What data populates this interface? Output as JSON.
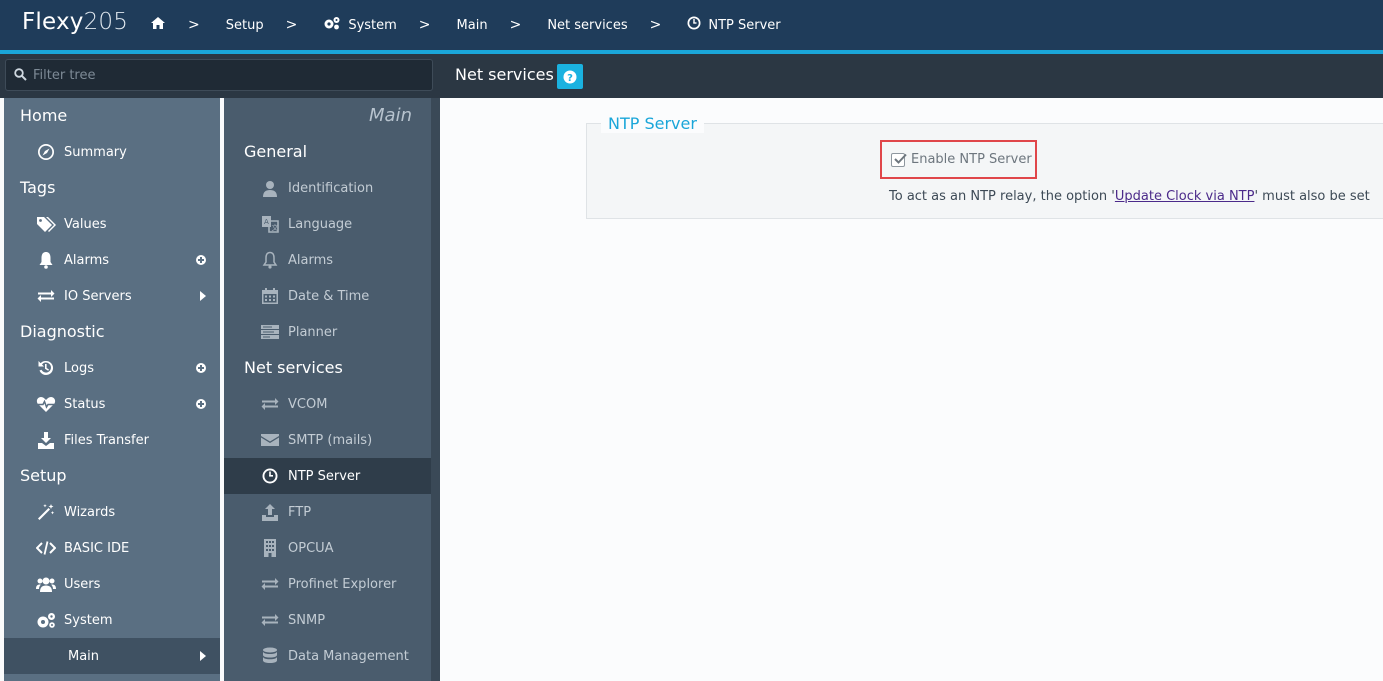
{
  "app": {
    "logo_main": "Flexy",
    "logo_model": "205"
  },
  "breadcrumb": {
    "items": [
      {
        "label": "",
        "icon": "home-icon"
      },
      {
        "label": "Setup"
      },
      {
        "label": "System",
        "icon": "gears-icon"
      },
      {
        "label": "Main"
      },
      {
        "label": "Net services"
      },
      {
        "label": "NTP Server",
        "icon": "clock-icon"
      }
    ],
    "separator": ">"
  },
  "filter": {
    "placeholder": "Filter tree"
  },
  "page": {
    "title": "Net services",
    "help_label": "?"
  },
  "nav1": {
    "sections": [
      {
        "label": "Home",
        "items": [
          {
            "label": "Summary",
            "icon": "compass-icon"
          }
        ]
      },
      {
        "label": "Tags",
        "items": [
          {
            "label": "Values",
            "icon": "tags-icon"
          },
          {
            "label": "Alarms",
            "icon": "bell-icon",
            "trail": "plus"
          },
          {
            "label": "IO Servers",
            "icon": "exchange-icon",
            "trail": "arrow"
          }
        ]
      },
      {
        "label": "Diagnostic",
        "items": [
          {
            "label": "Logs",
            "icon": "history-icon",
            "trail": "plus"
          },
          {
            "label": "Status",
            "icon": "heartbeat-icon",
            "trail": "plus"
          },
          {
            "label": "Files Transfer",
            "icon": "download-icon"
          }
        ]
      },
      {
        "label": "Setup",
        "items": [
          {
            "label": "Wizards",
            "icon": "magic-wand-icon"
          },
          {
            "label": "BASIC IDE",
            "icon": "code-icon"
          },
          {
            "label": "Users",
            "icon": "users-icon"
          },
          {
            "label": "System",
            "icon": "gears-icon"
          },
          {
            "label": "Main",
            "trail": "arrow",
            "active": true
          }
        ]
      }
    ]
  },
  "nav2": {
    "header": "Main",
    "sections": [
      {
        "label": "General",
        "items": [
          {
            "label": "Identification",
            "icon": "user-icon"
          },
          {
            "label": "Language",
            "icon": "language-icon"
          },
          {
            "label": "Alarms",
            "icon": "bell-outline-icon"
          },
          {
            "label": "Date & Time",
            "icon": "calendar-icon"
          },
          {
            "label": "Planner",
            "icon": "planner-icon"
          }
        ]
      },
      {
        "label": "Net services",
        "items": [
          {
            "label": "VCOM",
            "icon": "exchange-icon"
          },
          {
            "label": "SMTP (mails)",
            "icon": "envelope-icon"
          },
          {
            "label": "NTP Server",
            "icon": "clock-icon",
            "active": true
          },
          {
            "label": "FTP",
            "icon": "upload-icon"
          },
          {
            "label": "OPCUA",
            "icon": "building-icon"
          },
          {
            "label": "Profinet Explorer",
            "icon": "exchange-icon"
          },
          {
            "label": "SNMP",
            "icon": "exchange-icon"
          },
          {
            "label": "Data Management",
            "icon": "database-icon"
          }
        ]
      }
    ]
  },
  "ntp": {
    "legend": "NTP Server",
    "enable_label": "Enable NTP Server",
    "enable_checked": true,
    "note_prefix": "To act as an NTP relay, the option '",
    "note_link": "Update Clock via NTP",
    "note_suffix": "' must also be set"
  },
  "colors": {
    "topbar": "#1f3c5a",
    "accent": "#1aa6d9",
    "highlight_border": "#e0464a"
  }
}
